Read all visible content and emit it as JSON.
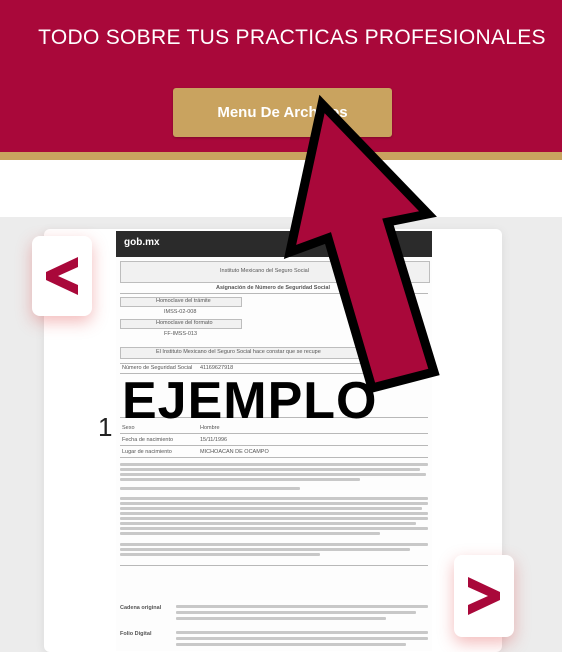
{
  "header": {
    "title": "TODO SOBRE TUS PRACTICAS PROFESIONALES",
    "menu_button_label": "Menu De Archivos",
    "colors": {
      "background": "#a9083a",
      "accent": "#c9a35f"
    }
  },
  "gallery": {
    "slide_number": "1",
    "prev_icon": "chevron-left-icon",
    "next_icon": "chevron-right-icon"
  },
  "document": {
    "logo": "gob.mx",
    "institution": "Instituto Mexicano del Seguro Social",
    "heading": "Asignación de Número de Seguridad Social",
    "watermark": "EJEMPLO",
    "fields": [
      {
        "label": "Homoclave del trámite",
        "value": "IMSS-02-008"
      },
      {
        "label": "Homoclave del formato",
        "value": "FF-IMSS-013"
      }
    ],
    "statement": "El Instituto Mexicano del Seguro Social hace constar que se recupe",
    "rows": [
      {
        "label": "Número de Seguridad Social",
        "value": "41169627918"
      },
      {
        "label": "Sexo",
        "value": "Hombre"
      },
      {
        "label": "Fecha de nacimiento",
        "value": "15/11/1996"
      },
      {
        "label": "Lugar de nacimiento",
        "value": "MICHOACAN DE OCAMPO"
      }
    ],
    "footer_labels": [
      "Cadena original",
      "Folio Digital"
    ]
  },
  "overlay": {
    "icon": "pointer-arrow-icon",
    "color": "#a9083a"
  }
}
